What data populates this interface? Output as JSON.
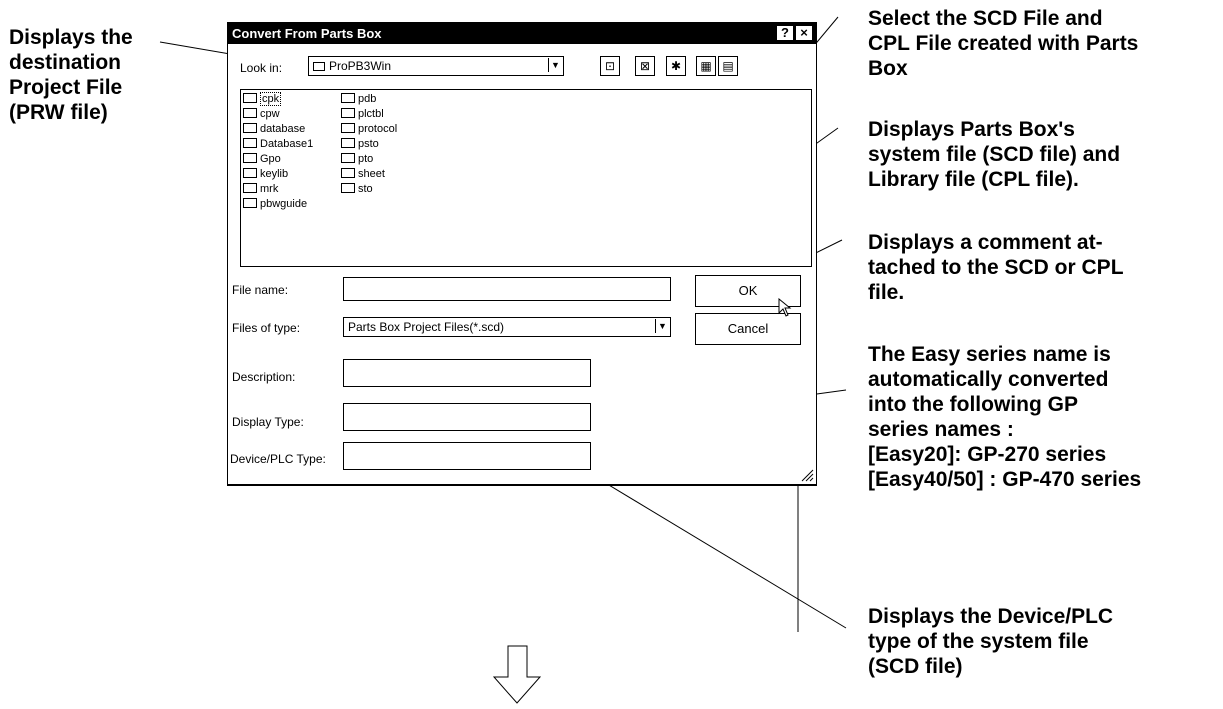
{
  "dialog": {
    "title": "Convert From Parts Box",
    "help_label": "?",
    "close_label": "×",
    "look_in_label": "Look in:",
    "look_in_value": "ProPB3Win",
    "files_left": [
      "cpk",
      "cpw",
      "database",
      "Database1",
      "Gpo",
      "keylib",
      "mrk",
      "pbwguide"
    ],
    "files_right": [
      "pdb",
      "plctbl",
      "protocol",
      "psto",
      "pto",
      "sheet",
      "sto"
    ],
    "file_name_label": "File name:",
    "file_name_value": "",
    "files_of_type_label": "Files of type:",
    "files_of_type_value": "Parts Box Project Files(*.scd)",
    "description_label": "Description:",
    "display_type_label": "Display Type:",
    "device_plc_type_label": "Device/PLC Type:",
    "ok_label": "OK",
    "cancel_label": "Cancel"
  },
  "callouts": {
    "left": [
      "Displays the",
      "destination",
      "Project File",
      "(PRW file)"
    ],
    "select": [
      "Select the SCD File and",
      "CPL File created with Parts",
      "Box"
    ],
    "system": [
      "Displays Parts Box's",
      "system file (SCD file) and",
      "Library file (CPL file)."
    ],
    "comment": [
      "Displays a comment at-",
      "tached to the SCD or CPL",
      "file."
    ],
    "easy": [
      "The Easy series name is",
      "automatically converted",
      "into the following GP",
      "series names :",
      "[Easy20]: GP-270 series",
      "[Easy40/50] : GP-470 series"
    ],
    "device": [
      "Displays the Device/PLC",
      "type of the system file",
      "(SCD file)"
    ]
  }
}
